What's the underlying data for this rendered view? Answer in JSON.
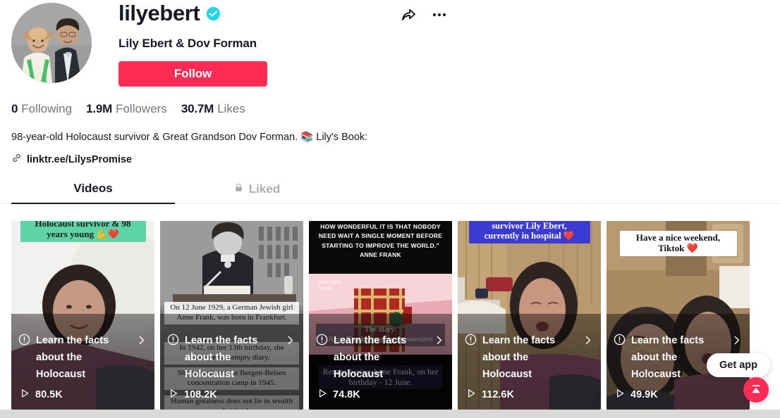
{
  "profile": {
    "username": "lilyebert",
    "verified_badge": "verified-check-icon",
    "display_name": "Lily Ebert & Dov Forman",
    "follow_label": "Follow",
    "avatar_alt": "elderly-woman-and-young-man-portrait",
    "bio": "98-year-old Holocaust survivor & Great Grandson Dov Forman. 📚 Lily's Book:",
    "link": "linktr.ee/LilysPromise",
    "link_icon": "link-chain-icon"
  },
  "header_actions": {
    "share_icon": "share-arrow-icon",
    "more_icon": "more-ellipsis-icon"
  },
  "stats": [
    {
      "value": "0",
      "label": "Following",
      "name": "following"
    },
    {
      "value": "1.9M",
      "label": "Followers",
      "name": "followers"
    },
    {
      "value": "30.7M",
      "label": "Likes",
      "name": "likes"
    }
  ],
  "tabs": [
    {
      "label": "Videos",
      "active": true,
      "icon": null
    },
    {
      "label": "Liked",
      "active": false,
      "icon": "lock-icon"
    }
  ],
  "colors": {
    "brand_red": "#FE2C55",
    "verified_cyan": "#20D5EC",
    "text_primary": "#161823",
    "text_secondary": "#73747b",
    "tab_inactive": "#acadb2"
  },
  "overlay_banner": {
    "label": "Learn the facts about the Holocaust",
    "info_icon": "info-circle-icon",
    "chevron_icon": "chevron-right-icon"
  },
  "videos": [
    {
      "views": "80.5K",
      "play_icon": "play-triangle-icon",
      "caption": "Holocaust survivor & 98\nyears young 💪❤️",
      "caption_style": "green-banner",
      "thumb": "elderly-woman-lying-in-bed"
    },
    {
      "views": "108.2K",
      "play_icon": "play-triangle-icon",
      "caption": "On 12 June 1929, a German Jewish girl Anne Frank, was born in Frankfurt.",
      "caption2": "In 1942, on her 13th birthday, she received an empty diary.",
      "caption3": "She passed away in Bergen-Belsen concentration camp in 1945.",
      "caption4": "Human greatness does not lie in wealth or power, but in character",
      "caption_style": "white-subtitle",
      "thumb": "anne-frank-black-and-white-photo-at-desk"
    },
    {
      "views": "74.8K",
      "play_icon": "play-triangle-icon",
      "caption": "HOW WONDERFUL IT IS THAT NOBODY\nNEED WAIT A SINGLE MOMENT BEFORE\nSTARTING TO IMPROVE THE WORLD.\"\nANNE FRANK",
      "caption2": "The diary:\nAnne Frank's precious possession",
      "caption3": "Remembering Anne Frank, on her birthday - 12 June.",
      "caption_style": "quote-on-black",
      "thumb": "red-plaid-diary-on-pink-background",
      "watermark": "anne frank\nhouse"
    },
    {
      "views": "112.6K",
      "play_icon": "play-triangle-icon",
      "caption": "survivor Lily Ebert,\ncurrently in hospital ❤️",
      "caption_style": "blue-banner",
      "thumb": "elderly-woman-in-hospital-bed"
    },
    {
      "views": "49.9K",
      "play_icon": "play-triangle-icon",
      "caption": "Have a nice weekend,\nTiktok ❤️",
      "caption_style": "white-banner",
      "thumb": "young-man-and-elderly-woman-selfie"
    }
  ],
  "floating": {
    "get_app_label": "Get app",
    "scroll_top_icon": "scroll-to-top-icon"
  }
}
